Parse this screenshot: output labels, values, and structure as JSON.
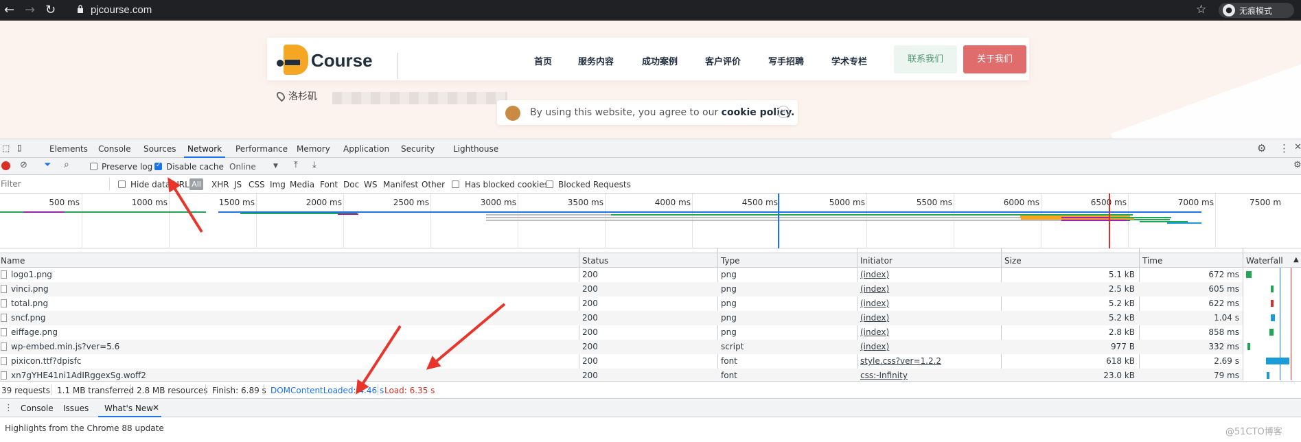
{
  "browser": {
    "url": "pjcourse.com",
    "incognito_label": "无痕模式"
  },
  "site": {
    "logo_text": "Course",
    "menu": [
      "首页",
      "服务内容",
      "成功案例",
      "客户评价",
      "写手招聘",
      "学术专栏"
    ],
    "contact_button": "联系我们",
    "about_button": "关于我们",
    "location": "洛杉矶",
    "cookie_text": "By using this website, you agree to our",
    "cookie_link": "cookie policy."
  },
  "devtools": {
    "tabs": [
      "Elements",
      "Console",
      "Sources",
      "Network",
      "Performance",
      "Memory",
      "Application",
      "Security",
      "Lighthouse"
    ],
    "active_tab": "Network",
    "toolbar": {
      "preserve_log": "Preserve log",
      "disable_cache": "Disable cache",
      "throttle": "Online"
    },
    "filter": {
      "placeholder": "Filter",
      "hide_data_urls": "Hide data URLs",
      "all": "All",
      "types": [
        "XHR",
        "JS",
        "CSS",
        "Img",
        "Media",
        "Font",
        "Doc",
        "WS",
        "Manifest",
        "Other"
      ],
      "blocked_cookies": "Has blocked cookies",
      "blocked_requests": "Blocked Requests"
    },
    "overview_ticks": [
      "500 ms",
      "1000 ms",
      "1500 ms",
      "2000 ms",
      "2500 ms",
      "3000 ms",
      "3500 ms",
      "4000 ms",
      "4500 ms",
      "5000 ms",
      "5500 ms",
      "6000 ms",
      "6500 ms",
      "7000 ms",
      "7500 m"
    ],
    "columns": {
      "name": "Name",
      "status": "Status",
      "type": "Type",
      "initiator": "Initiator",
      "size": "Size",
      "time": "Time",
      "waterfall": "Waterfall"
    },
    "rows": [
      {
        "name": "logo1.png",
        "status": "200",
        "type": "png",
        "initiator": "(index)",
        "size": "5.1 kB",
        "time": "672 ms"
      },
      {
        "name": "vinci.png",
        "status": "200",
        "type": "png",
        "initiator": "(index)",
        "size": "2.5 kB",
        "time": "605 ms"
      },
      {
        "name": "total.png",
        "status": "200",
        "type": "png",
        "initiator": "(index)",
        "size": "5.2 kB",
        "time": "622 ms"
      },
      {
        "name": "sncf.png",
        "status": "200",
        "type": "png",
        "initiator": "(index)",
        "size": "5.2 kB",
        "time": "1.04 s"
      },
      {
        "name": "eiffage.png",
        "status": "200",
        "type": "png",
        "initiator": "(index)",
        "size": "2.8 kB",
        "time": "858 ms"
      },
      {
        "name": "wp-embed.min.js?ver=5.6",
        "status": "200",
        "type": "script",
        "initiator": "(index)",
        "size": "977 B",
        "time": "332 ms"
      },
      {
        "name": "pixicon.ttf?dpisfc",
        "status": "200",
        "type": "font",
        "initiator": "style.css?ver=1.2.2",
        "size": "618 kB",
        "time": "2.69 s"
      },
      {
        "name": "xn7gYHE41ni1AdIRggexSg.woff2",
        "status": "200",
        "type": "font",
        "initiator": "css:-Infinity",
        "size": "23.0 kB",
        "time": "79 ms"
      }
    ],
    "summary": {
      "requests": "39 requests",
      "transferred": "1.1 MB transferred",
      "resources": "2.8 MB resources",
      "finish": "Finish: 6.89 s",
      "dcl": "DOMContentLoaded: 4.46 s",
      "load": "Load: 6.35 s"
    },
    "drawer_tabs": [
      "Console",
      "Issues",
      "What's New"
    ],
    "highlights": "Highlights from the Chrome 88 update",
    "colors": {
      "dcl": "#1a73e8",
      "load": "#d93025",
      "accent": "#1a73e8"
    }
  },
  "watermark": "@51CTO博客"
}
